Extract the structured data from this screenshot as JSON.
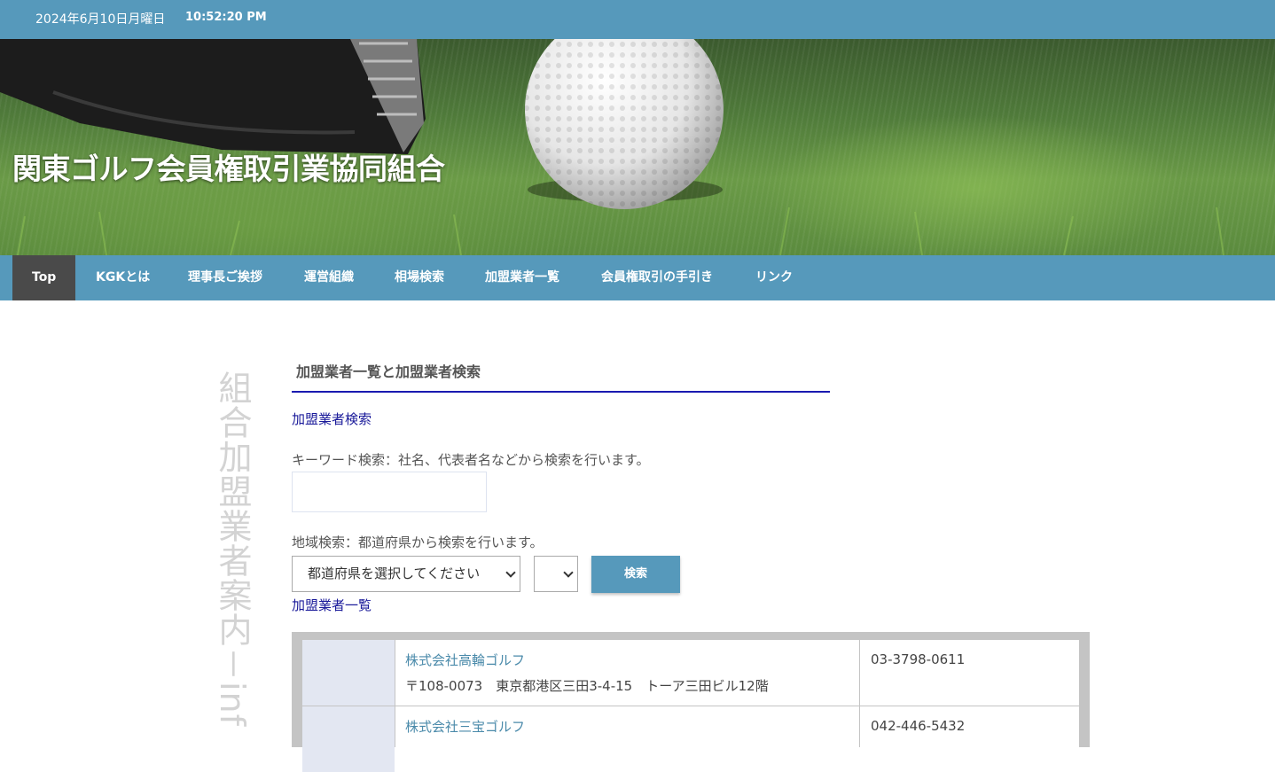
{
  "topbar": {
    "date": "2024年6月10日月曜日",
    "time": "10:52:20 PM"
  },
  "banner": {
    "title": "関東ゴルフ会員権取引業協同組合"
  },
  "nav": {
    "items": [
      "Top",
      "KGKとは",
      "理事長ご挨拶",
      "運営組織",
      "相場検索",
      "加盟業者一覧",
      "会員権取引の手引き",
      "リンク"
    ]
  },
  "sidebar": {
    "vertical_text": "組合加盟業者案内－inf"
  },
  "main": {
    "section_title": "加盟業者一覧と加盟業者検索",
    "search_link": "加盟業者検索",
    "keyword_label": "キーワード検索：社名、代表者名などから検索を行います。",
    "keyword_value": "",
    "region_label": "地域検索：都道府県から検索を行います。",
    "prefecture_selected": "都道府県を選択してください",
    "city_selected": "",
    "search_button": "検索",
    "list_link": "加盟業者一覧"
  },
  "members": [
    {
      "name": "株式会社高輪ゴルフ",
      "address": "〒108-0073　東京都港区三田3-4-15　トーア三田ビル12階",
      "phone": "03-3798-0611"
    },
    {
      "name": "株式会社三宝ゴルフ",
      "address": "",
      "phone": "042-446-5432"
    }
  ],
  "colors": {
    "accent": "#5699bb",
    "nav_active": "#4a4a4a",
    "link": "#1a1a9a",
    "rule": "#1a1ab0"
  }
}
